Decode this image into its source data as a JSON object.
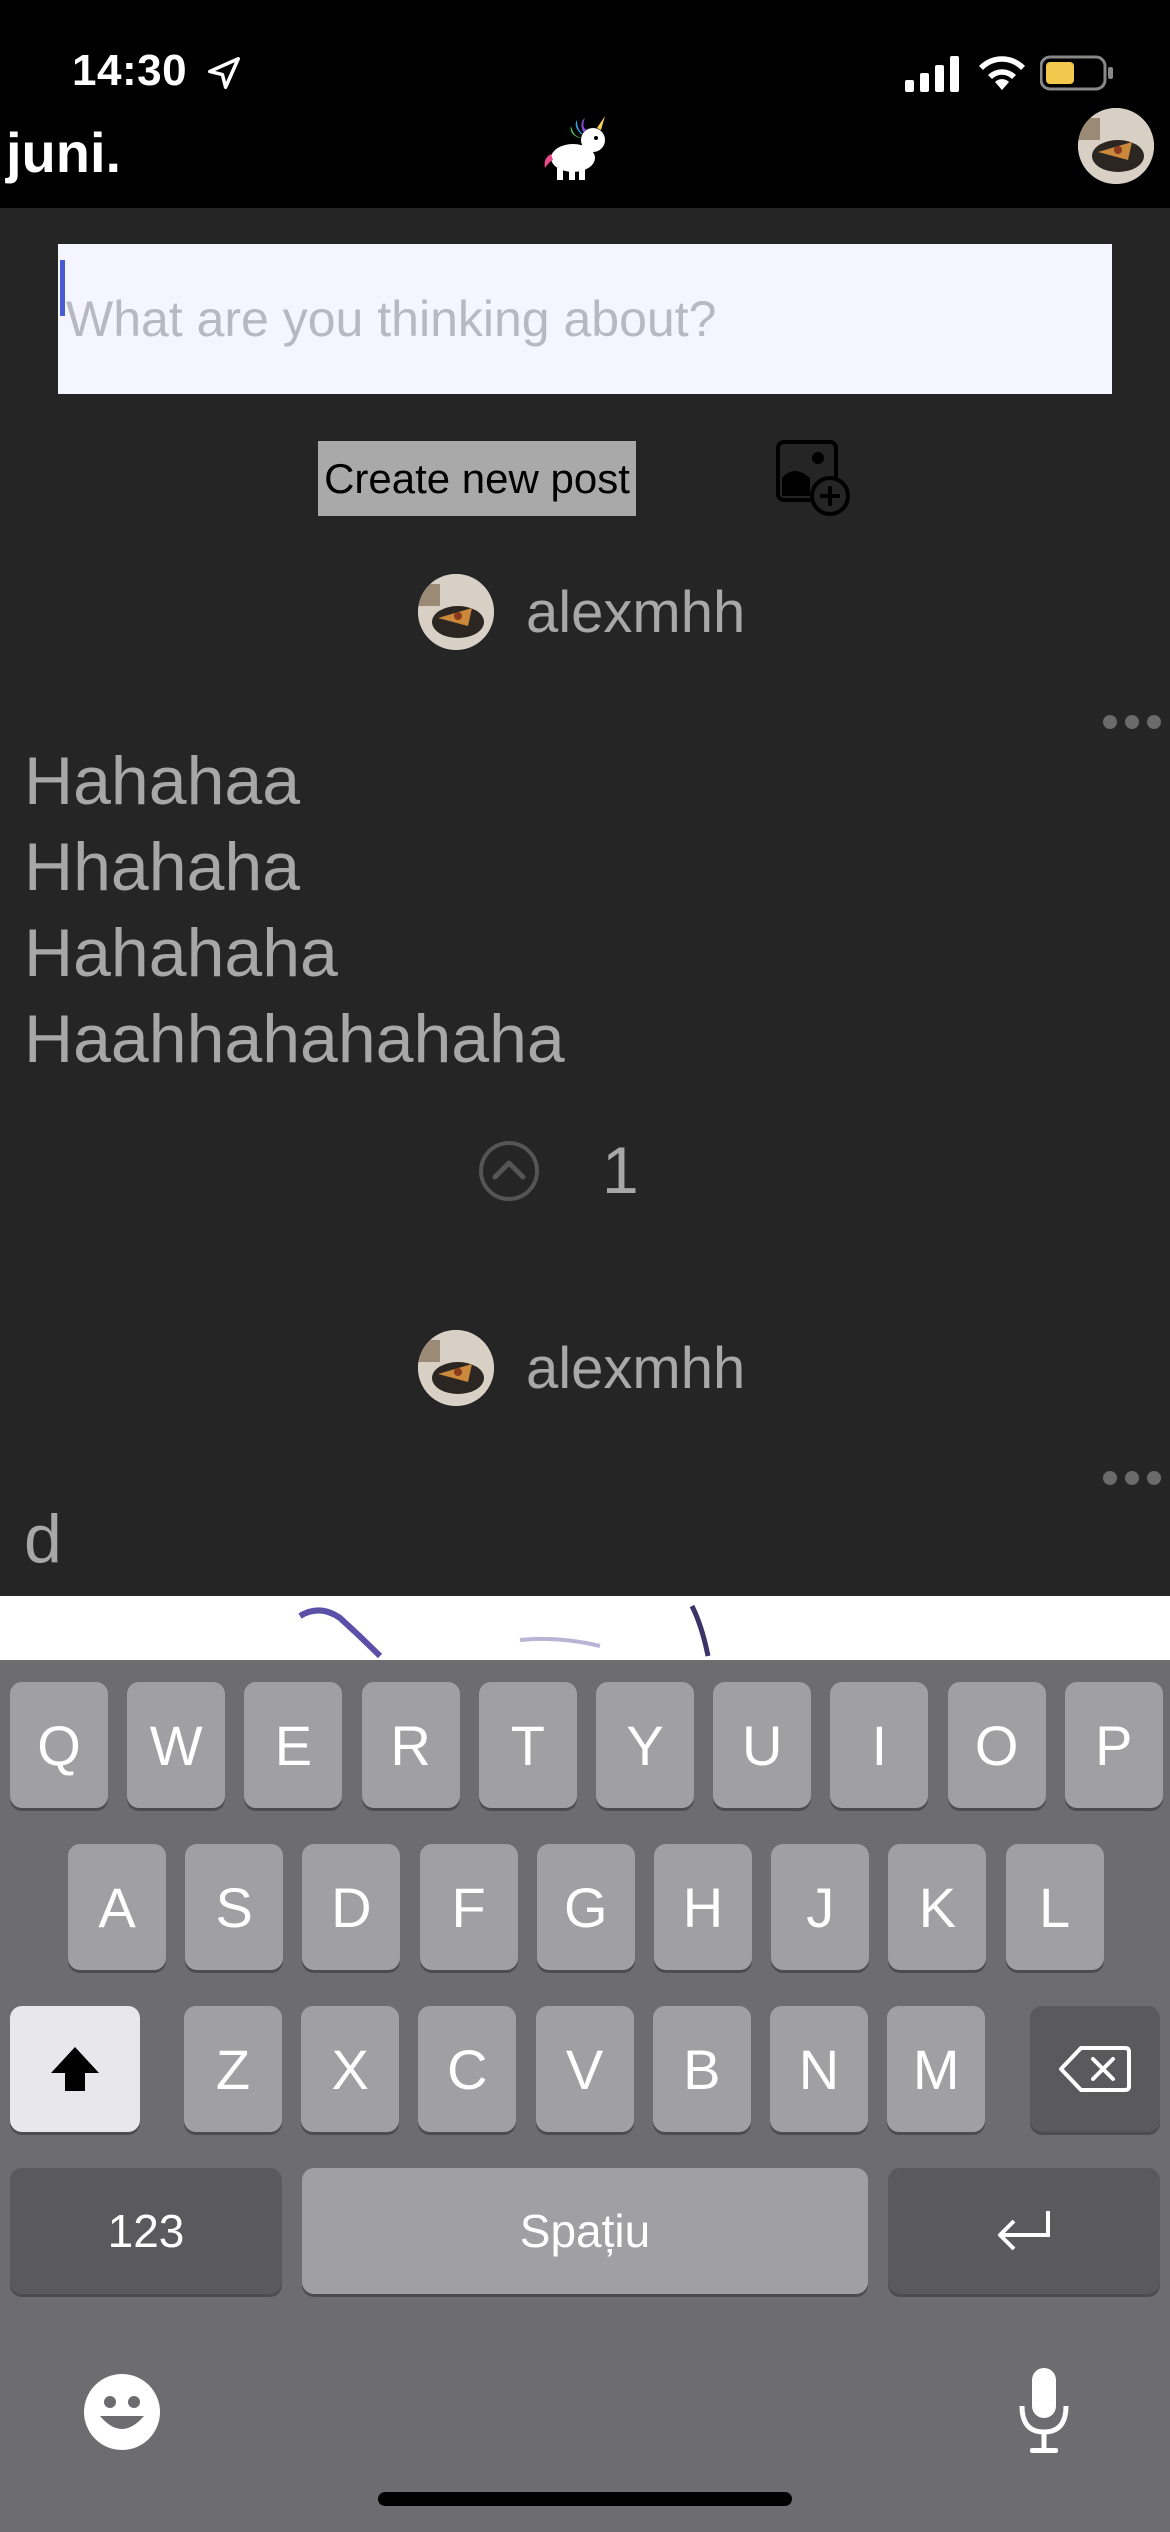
{
  "status_bar": {
    "time": "14:30"
  },
  "header": {
    "brand": "juni."
  },
  "composer": {
    "placeholder": "What are you thinking about?",
    "value": ""
  },
  "actions": {
    "create_post_label": "Create new post"
  },
  "posts": [
    {
      "author": "alexmhh",
      "lines": [
        "Hahahaa",
        "Hhahaha",
        "Hahahaha",
        "Haahhahahahaha"
      ],
      "votes": "1"
    },
    {
      "author": "alexmhh",
      "lines": [
        "d"
      ]
    }
  ],
  "keyboard": {
    "row1": [
      "Q",
      "W",
      "E",
      "R",
      "T",
      "Y",
      "U",
      "I",
      "O",
      "P"
    ],
    "row2": [
      "A",
      "S",
      "D",
      "F",
      "G",
      "H",
      "J",
      "K",
      "L"
    ],
    "row3": [
      "Z",
      "X",
      "C",
      "V",
      "B",
      "N",
      "M"
    ],
    "numbers_label": "123",
    "space_label": "Spațiu"
  },
  "icons": {
    "location": "location-arrow-icon",
    "signal": "cellular-signal-icon",
    "wifi": "wifi-icon",
    "battery": "battery-icon",
    "logo": "unicorn-logo-icon",
    "add_image": "add-image-icon",
    "more": "more-dots-icon",
    "upvote": "upvote-icon",
    "shift": "shift-icon",
    "backspace": "backspace-icon",
    "return": "return-icon",
    "emoji": "emoji-icon",
    "mic": "microphone-icon"
  },
  "colors": {
    "battery": "#f2c94c",
    "cursor": "#4a5bd6",
    "background": "#252525"
  }
}
